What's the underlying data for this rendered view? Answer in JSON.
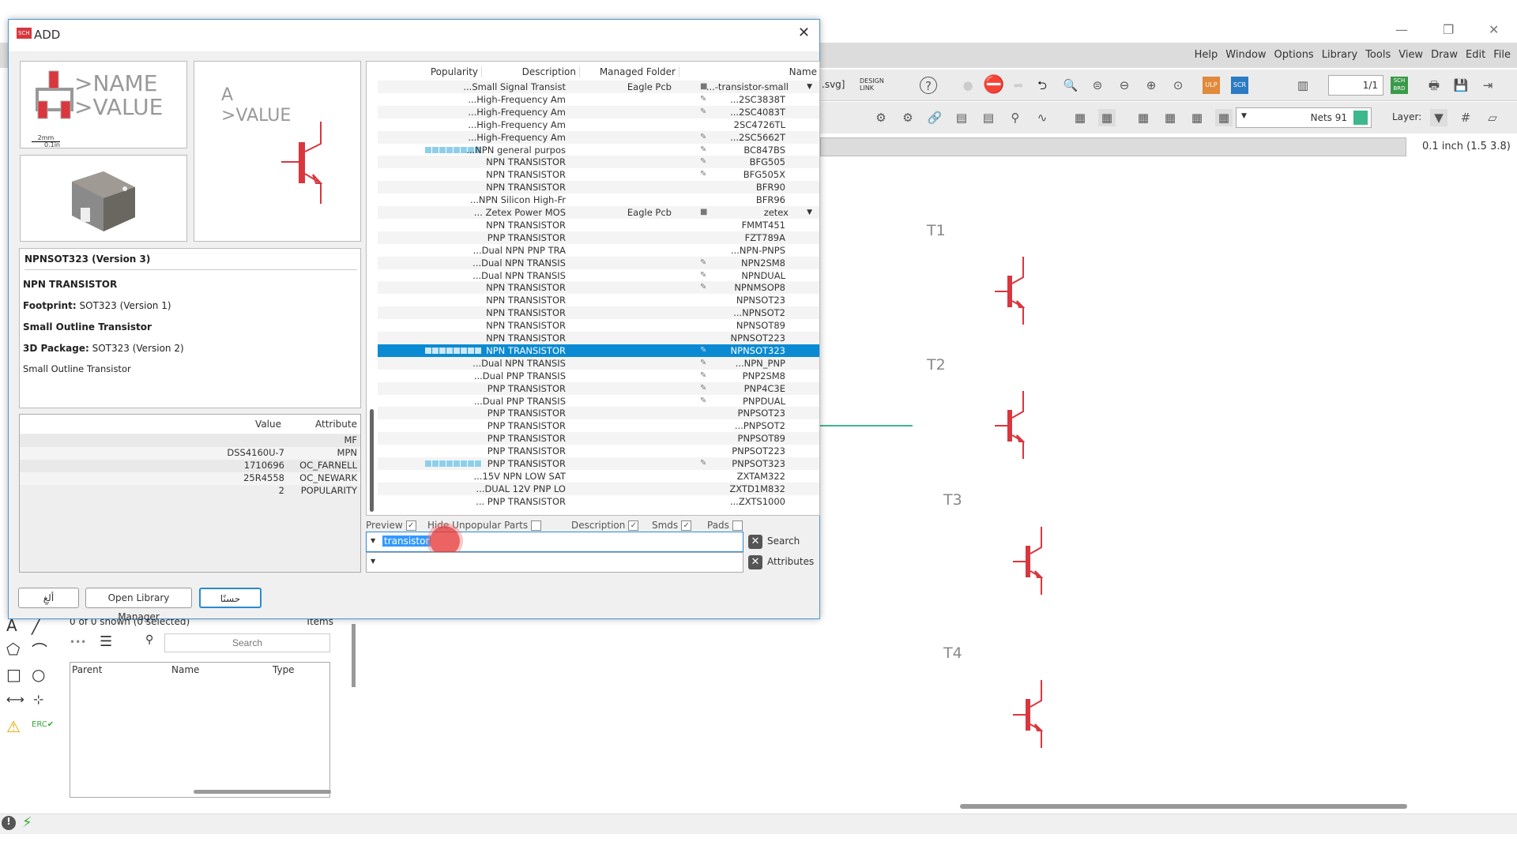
{
  "app": {
    "menu": [
      "File",
      "Edit",
      "Draw",
      "View",
      "Tools",
      "Library",
      "Options",
      "Window",
      "Help"
    ],
    "file_suffix": ".svg]",
    "design_link": "DESIGN LINK",
    "sheet": "1/1",
    "nets": "Nets 91",
    "nets_color": "#3cb88a",
    "layer_label": "Layer:",
    "grid_coord": "0.1 inch (1.5 3.8)",
    "parts": [
      "T1",
      "T2",
      "T3",
      "T4"
    ],
    "accent": "#d9363e"
  },
  "sidebar": {
    "status": "0 of 0 shown (0 selected)",
    "items_label": "Items",
    "search_placeholder": "Search",
    "columns": [
      "Parent",
      "Name",
      "Type"
    ]
  },
  "dialog": {
    "title": "ADD",
    "preview": {
      "name": ">NAME",
      "value": ">VALUE",
      "scale_mm": "2mm",
      "scale_in": "0.1in",
      "sym_name": "A",
      "sym_value": ">VALUE"
    },
    "info": {
      "title": "NPNSOT323 (Version 3)",
      "desc": "NPN TRANSISTOR",
      "footprint_label": "Footprint:",
      "footprint": "SOT323 (Version 1)",
      "footprint_desc": "Small Outline Transistor",
      "pkg3d_label": "3D Package:",
      "pkg3d": "SOT323 (Version 2)",
      "pkg3d_desc": "Small Outline Transistor"
    },
    "attributes": {
      "columns": [
        "Value",
        "Attribute"
      ],
      "rows": [
        [
          "",
          "MF"
        ],
        [
          "DSS4160U-7",
          "MPN"
        ],
        [
          "1710696",
          "OC_FARNELL"
        ],
        [
          "25R4558",
          "OC_NEWARK"
        ],
        [
          "2",
          "POPULARITY"
        ]
      ]
    },
    "list": {
      "columns": [
        "Popularity",
        "Description",
        "Managed Folder",
        "Name"
      ],
      "rows": [
        {
          "pop": 0,
          "desc": "...Small Signal Transist",
          "folder": "Eagle Pcb",
          "icon": "lock",
          "name": "...-transistor-small",
          "expand": true
        },
        {
          "pop": 0,
          "desc": "...High-Frequency Am",
          "folder": "",
          "icon": "pen",
          "name": "...2SC3838T"
        },
        {
          "pop": 0,
          "desc": "...High-Frequency Am",
          "folder": "",
          "icon": "pen",
          "name": "...2SC4083T"
        },
        {
          "pop": 0,
          "desc": "...High-Frequency Am",
          "folder": "",
          "icon": "",
          "name": "2SC4726TL"
        },
        {
          "pop": 0,
          "desc": "...High-Frequency Am",
          "folder": "",
          "icon": "pen",
          "name": "...2SC5662T"
        },
        {
          "pop": 1,
          "desc": "...NPN general purpos",
          "folder": "",
          "icon": "pen",
          "name": "BC847BS"
        },
        {
          "pop": 0,
          "desc": "NPN TRANSISTOR",
          "folder": "",
          "icon": "pen",
          "name": "BFG505"
        },
        {
          "pop": 0,
          "desc": "NPN TRANSISTOR",
          "folder": "",
          "icon": "pen",
          "name": "BFG505X"
        },
        {
          "pop": 0,
          "desc": "NPN TRANSISTOR",
          "folder": "",
          "icon": "",
          "name": "BFR90"
        },
        {
          "pop": 0,
          "desc": "...NPN Silicon High-Fr",
          "folder": "",
          "icon": "",
          "name": "BFR96"
        },
        {
          "pop": 0,
          "desc": "... Zetex Power MOS",
          "folder": "Eagle Pcb",
          "icon": "lock",
          "name": "zetex",
          "expand": true
        },
        {
          "pop": 0,
          "desc": "NPN TRANSISTOR",
          "folder": "",
          "icon": "",
          "name": "FMMT451"
        },
        {
          "pop": 0,
          "desc": "PNP TRANSISTOR",
          "folder": "",
          "icon": "",
          "name": "FZT789A"
        },
        {
          "pop": 0,
          "desc": "...Dual NPN PNP TRA",
          "folder": "",
          "icon": "",
          "name": "...NPN-PNPS"
        },
        {
          "pop": 0,
          "desc": "...Dual NPN TRANSIS",
          "folder": "",
          "icon": "pen",
          "name": "NPN2SM8"
        },
        {
          "pop": 0,
          "desc": "...Dual NPN TRANSIS",
          "folder": "",
          "icon": "pen",
          "name": "NPNDUAL"
        },
        {
          "pop": 0,
          "desc": "NPN TRANSISTOR",
          "folder": "",
          "icon": "pen",
          "name": "NPNMSOP8"
        },
        {
          "pop": 0,
          "desc": "NPN TRANSISTOR",
          "folder": "",
          "icon": "",
          "name": "NPNSOT23"
        },
        {
          "pop": 0,
          "desc": "NPN TRANSISTOR",
          "folder": "",
          "icon": "",
          "name": "...NPNSOT2"
        },
        {
          "pop": 0,
          "desc": "NPN TRANSISTOR",
          "folder": "",
          "icon": "",
          "name": "NPNSOT89"
        },
        {
          "pop": 0,
          "desc": "NPN TRANSISTOR",
          "folder": "",
          "icon": "",
          "name": "NPNSOT223"
        },
        {
          "pop": 1,
          "desc": "NPN TRANSISTOR",
          "folder": "",
          "icon": "pen",
          "name": "NPNSOT323",
          "selected": true
        },
        {
          "pop": 0,
          "desc": "...Dual NPN TRANSIS",
          "folder": "",
          "icon": "pen",
          "name": "...NPN_PNP"
        },
        {
          "pop": 0,
          "desc": "...Dual PNP TRANSIS",
          "folder": "",
          "icon": "pen",
          "name": "PNP2SM8"
        },
        {
          "pop": 0,
          "desc": "PNP TRANSISTOR",
          "folder": "",
          "icon": "pen",
          "name": "PNP4C3E"
        },
        {
          "pop": 0,
          "desc": "...Dual PNP TRANSIS",
          "folder": "",
          "icon": "pen",
          "name": "PNPDUAL"
        },
        {
          "pop": 0,
          "desc": "PNP TRANSISTOR",
          "folder": "",
          "icon": "",
          "name": "PNPSOT23"
        },
        {
          "pop": 0,
          "desc": "PNP TRANSISTOR",
          "folder": "",
          "icon": "",
          "name": "...PNPSOT2"
        },
        {
          "pop": 0,
          "desc": "PNP TRANSISTOR",
          "folder": "",
          "icon": "",
          "name": "PNPSOT89"
        },
        {
          "pop": 0,
          "desc": "PNP TRANSISTOR",
          "folder": "",
          "icon": "",
          "name": "PNPSOT223"
        },
        {
          "pop": 1,
          "desc": "PNP TRANSISTOR",
          "folder": "",
          "icon": "pen",
          "name": "PNPSOT323"
        },
        {
          "pop": 0,
          "desc": "...15V NPN LOW SAT",
          "folder": "",
          "icon": "",
          "name": "ZXTAM322"
        },
        {
          "pop": 0,
          "desc": "...DUAL 12V PNP LO",
          "folder": "",
          "icon": "",
          "name": "ZXTD1M832"
        },
        {
          "pop": 0,
          "desc": "... PNP TRANSISTOR",
          "folder": "",
          "icon": "",
          "name": "...ZXTS1000"
        }
      ]
    },
    "filters": {
      "preview": "Preview",
      "preview_checked": true,
      "hide_unpopular": "Hide Unpopular Parts",
      "hide_unpopular_checked": false,
      "description": "Description",
      "description_checked": true,
      "smds": "Smds",
      "smds_checked": true,
      "pads": "Pads",
      "pads_checked": false
    },
    "search_value": "transistor",
    "attributes_value": "",
    "search_label": "Search",
    "attributes_label": "Attributes",
    "buttons": {
      "cancel": "ألغِ",
      "library_manager": "Open Library Manager",
      "ok": "حسنًا"
    }
  }
}
